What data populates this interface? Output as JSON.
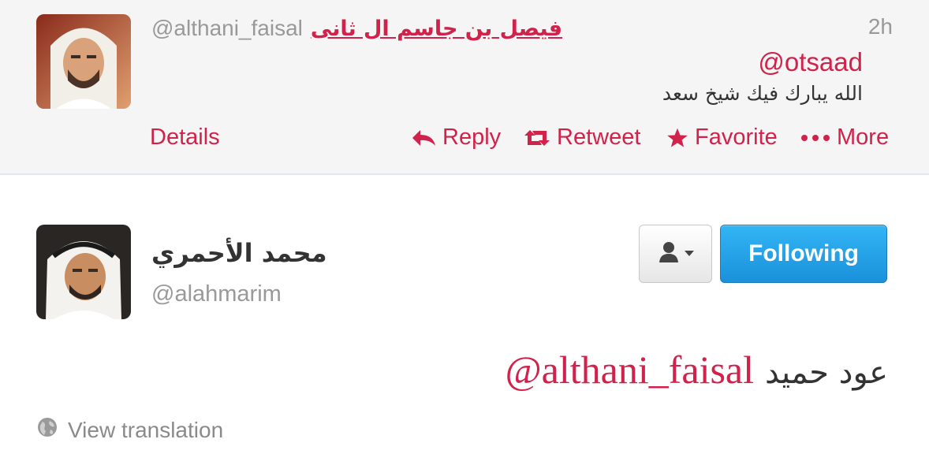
{
  "reply_tweet": {
    "full_name": "فيصل بن جاسم ال ثانى",
    "screen_name": "@althani_faisal",
    "timestamp": "2h",
    "mention": "@otsaad",
    "text": "الله يبارك فيك شيخ سعد",
    "actions": {
      "details": "Details",
      "reply": "Reply",
      "retweet": "Retweet",
      "favorite": "Favorite",
      "more": "More"
    }
  },
  "main_tweet": {
    "full_name": "محمد الأحمري",
    "screen_name": "@alahmarim",
    "follow_button": "Following",
    "mention": "@althani_faisal",
    "text": "عود حميد",
    "view_translation": "View translation"
  },
  "icons": {
    "reply": "reply-arrow-icon",
    "retweet": "retweet-icon",
    "favorite": "star-icon",
    "more": "ellipsis-icon",
    "user_dropdown": "person-icon",
    "translation": "globe-icon"
  },
  "colors": {
    "link": "#d0224b",
    "muted": "#999999",
    "follow_button": "#1a91db",
    "reply_bg": "#f5f5f5"
  }
}
